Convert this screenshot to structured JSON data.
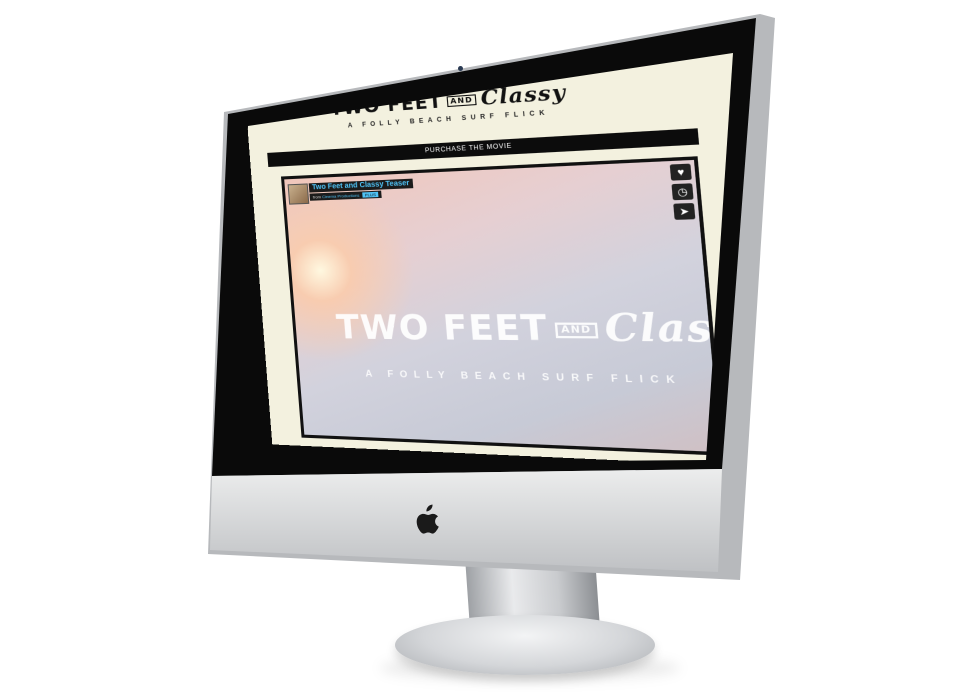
{
  "site": {
    "logo": {
      "word1": "TWO FEET",
      "and": "AND",
      "word2": "Classy"
    },
    "tagline": "A FOLLY BEACH SURF FLICK",
    "nav": {
      "purchase_label": "PURCHASE THE MOVIE"
    }
  },
  "video": {
    "title": "Two Feet and Classy Teaser",
    "byline": {
      "from": "from",
      "author": "Cinema Productions",
      "badge": "PLUS"
    },
    "overlay": {
      "word1": "TWO FEET",
      "and": "AND",
      "word2": "Classy",
      "tagline": "A FOLLY BEACH SURF FLICK"
    },
    "controls": [
      {
        "name": "like",
        "icon": "heart-icon",
        "glyph": "♥"
      },
      {
        "name": "watch-later",
        "icon": "clock-icon",
        "glyph": "◷"
      },
      {
        "name": "share",
        "icon": "paper-plane-icon",
        "glyph": "➤"
      }
    ]
  },
  "colors": {
    "page_bg": "#f3f1df",
    "nav_bg": "#0c0c0c",
    "link_blue": "#4fc3f7",
    "bezel": "#0a0a0a",
    "chin": "#d9dadc"
  }
}
